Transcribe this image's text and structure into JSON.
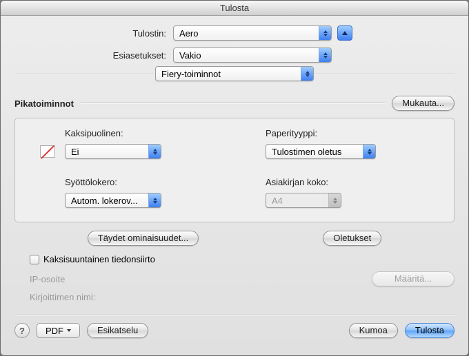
{
  "window": {
    "title": "Tulosta"
  },
  "form": {
    "printer_label": "Tulostin:",
    "printer_value": "Aero",
    "presets_label": "Esiasetukset:",
    "presets_value": "Vakio",
    "pane_value": "Fiery-toiminnot"
  },
  "pikatoiminnot": {
    "title": "Pikatoiminnot",
    "customize_label": "Mukauta...",
    "duplex_label": "Kaksipuolinen:",
    "duplex_value": "Ei",
    "papertype_label": "Paperityyppi:",
    "papertype_value": "Tulostimen oletus",
    "inputtray_label": "Syöttölokero:",
    "inputtray_value": "Autom. lokerov...",
    "docsize_label": "Asiakirjan koko:",
    "docsize_value": "A4"
  },
  "buttons": {
    "full_props": "Täydet ominaisuudet...",
    "defaults": "Oletukset"
  },
  "bidi": {
    "checkbox_label": "Kaksisuuntainen tiedonsiirto",
    "ip_label": "IP-osoite",
    "printer_name_label": "Kirjoittimen nimi:",
    "configure_label": "Määritä..."
  },
  "footer": {
    "pdf_label": "PDF",
    "preview_label": "Esikatselu",
    "cancel_label": "Kumoa",
    "print_label": "Tulosta"
  }
}
